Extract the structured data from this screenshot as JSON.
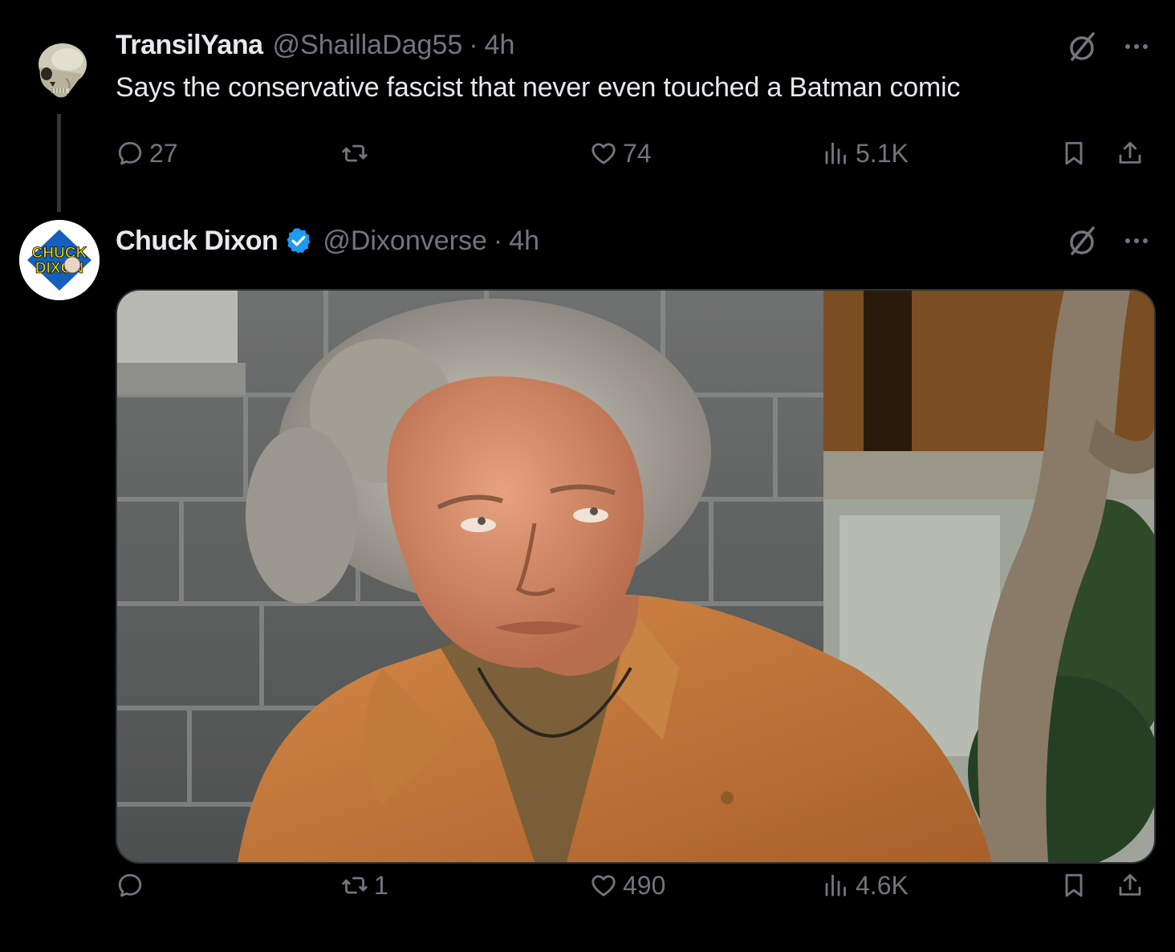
{
  "tweets": [
    {
      "display_name": "TransilYana",
      "handle": "@ShaillaDag55",
      "separator": "·",
      "time": "4h",
      "text": "Says the conservative fascist that never even touched a Batman comic",
      "avatar_icon": "skull-avatar",
      "verified": false,
      "actions": {
        "reply_count": "27",
        "repost_count": "",
        "like_count": "74",
        "view_count": "5.1K"
      }
    },
    {
      "display_name": "Chuck Dixon",
      "handle": "@Dixonverse",
      "separator": "·",
      "time": "4h",
      "verified": true,
      "avatar_icon": "chuck-dixon-logo-avatar",
      "avatar_logo_text": [
        "CHUCK",
        "DIXON"
      ],
      "media_description": "photo of a man with messy grey hair in an orange shirt rolling his eyes",
      "actions": {
        "reply_count": "",
        "repost_count": "1",
        "like_count": "490",
        "view_count": "4.6K"
      }
    }
  ],
  "colors": {
    "background": "#000000",
    "primary_text": "#e7e9ea",
    "secondary_text": "#71767b",
    "verified_blue": "#1d9bf0",
    "border": "#2f3336"
  },
  "icons": [
    "reply-icon",
    "repost-icon",
    "like-icon",
    "views-icon",
    "bookmark-icon",
    "share-icon",
    "grok-icon",
    "more-icon",
    "verified-badge-icon"
  ]
}
